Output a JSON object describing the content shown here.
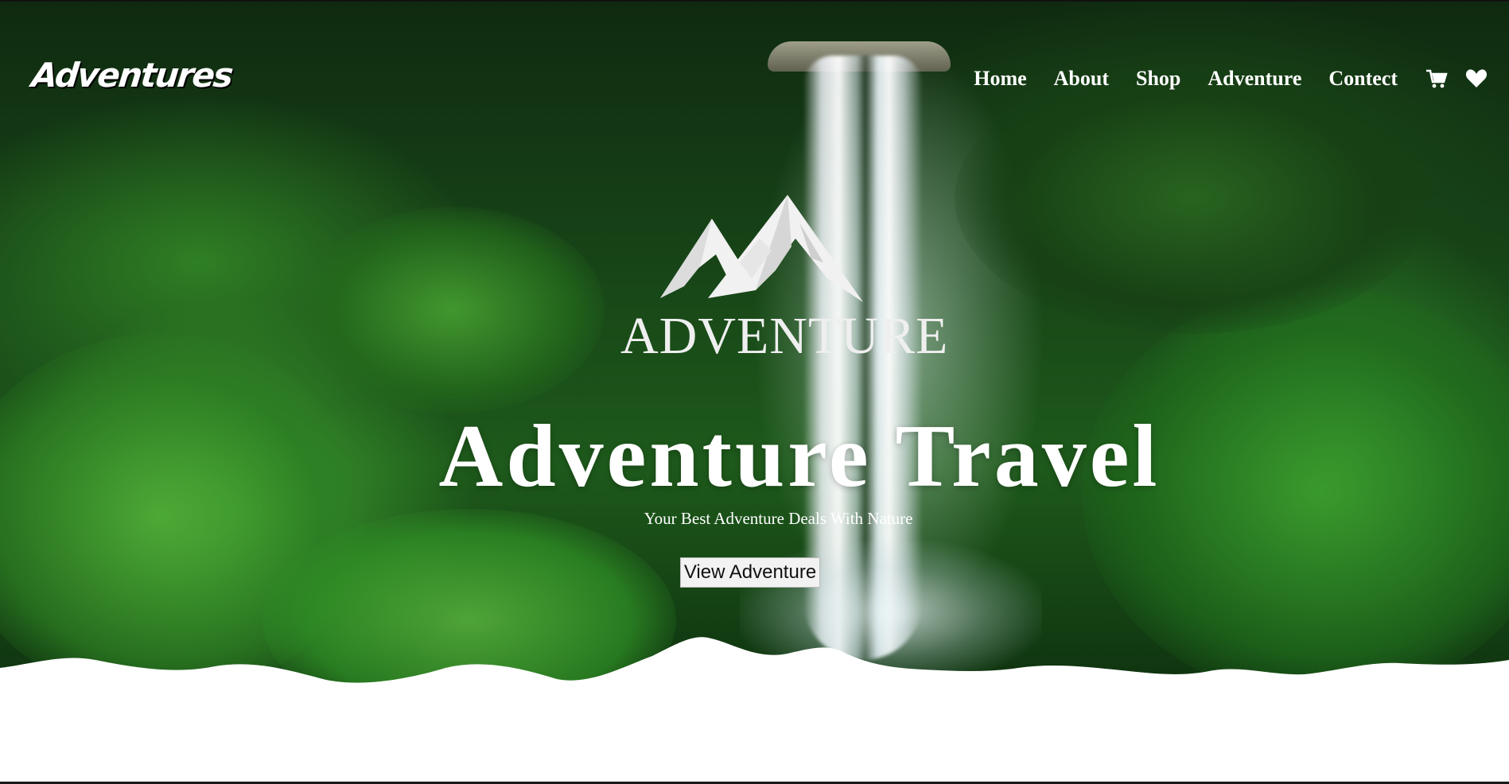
{
  "header": {
    "brand": "Adventures",
    "nav": [
      {
        "label": "Home"
      },
      {
        "label": "About"
      },
      {
        "label": "Shop"
      },
      {
        "label": "Adventure"
      },
      {
        "label": "Contect"
      }
    ],
    "icons": [
      "cart-icon",
      "heart-icon"
    ]
  },
  "hero": {
    "logo_text": "ADVENTURE",
    "headline": "Adventure Travel",
    "subtitle": "Your Best Adventure Deals With Nature",
    "cta_label": "View Adventure"
  },
  "colors": {
    "text": "#ffffff",
    "foliage": "#1e5a1b",
    "button_bg": "#f2f2f2"
  }
}
